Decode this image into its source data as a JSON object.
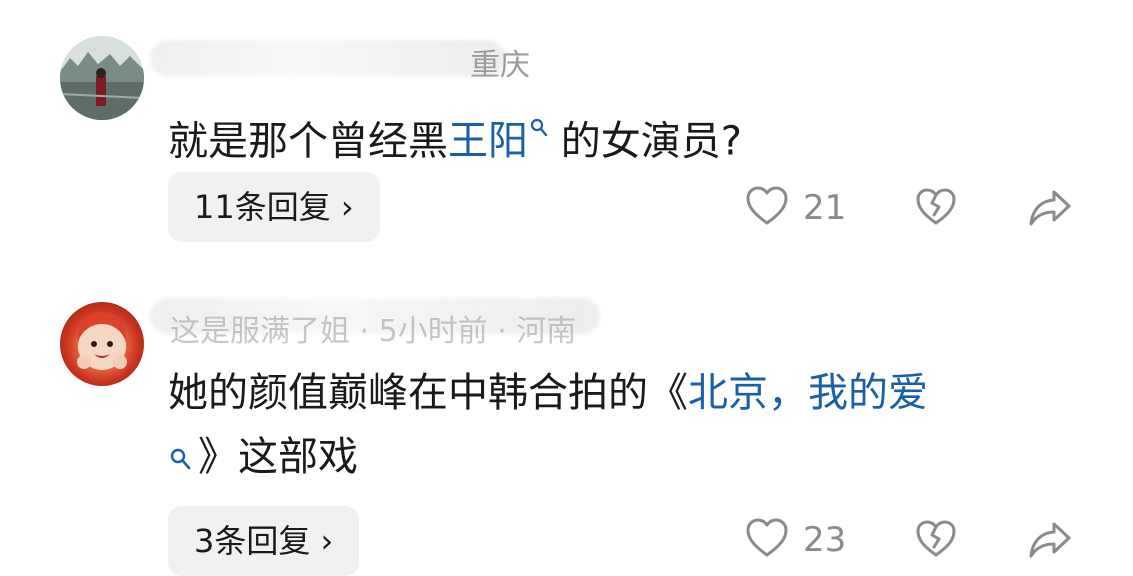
{
  "comments": [
    {
      "user": {
        "meta_visible": "重庆"
      },
      "text": {
        "prefix": "就是那个曾经黑",
        "link": "王阳",
        "suffix": "的女演员?"
      },
      "reply_label": "11条回复 ›",
      "like_count": "21"
    },
    {
      "user": {
        "meta_visible": "这是服满了姐 · 5小时前 · 河南"
      },
      "text": {
        "line1_prefix": "她的颜值巅峰在中韩合拍的《",
        "line1_link": "北京，我的爱",
        "line2_suffix": "》这部戏"
      },
      "reply_label": "3条回复 ›",
      "like_count": "23"
    }
  ],
  "icons": {
    "like": "heart-icon",
    "dislike": "broken-heart-icon",
    "share": "share-arrow-icon",
    "search": "search-magnifier-icon"
  },
  "colors": {
    "link": "#1a5fa8",
    "meta": "#9a9a9a",
    "chip_bg": "#f1f1f1"
  }
}
